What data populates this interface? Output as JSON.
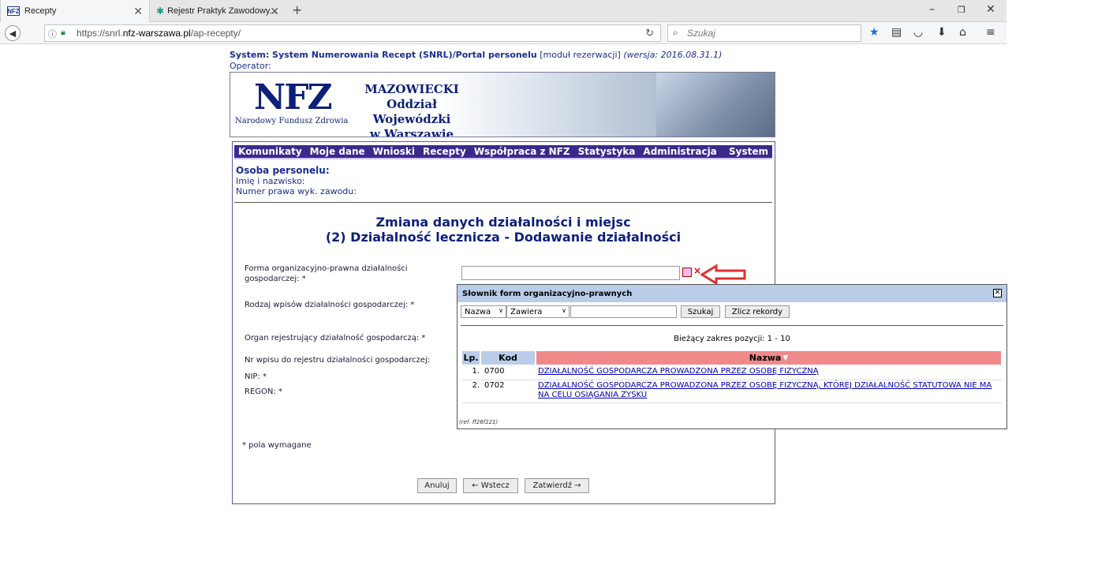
{
  "browser": {
    "tabs": [
      {
        "label": "Recepty",
        "icon": "NFZ"
      },
      {
        "label": "Rejestr Praktyk Zawodowy..."
      }
    ],
    "url_prefix": "https://snrl.",
    "url_domain": "nfz-warszawa.pl",
    "url_path": "/ap-recepty/",
    "search_placeholder": "Szukaj"
  },
  "header": {
    "system_bold": "System: System Numerowania Recept (SNRL)/Portal personelu",
    "system_module": " [moduł rezerwacji] ",
    "system_version": "(wersja: 2016.08.31.1)",
    "operator": "Operator:"
  },
  "banner": {
    "logo": "NFZ",
    "logo_sub": "Narodowy Fundusz Zdrowia",
    "line1": "MAZOWIECKI",
    "line2": "Oddział Wojewódzki",
    "line3": "w Warszawie"
  },
  "menu": [
    "Komunikaty",
    "Moje dane",
    "Wnioski",
    "Recepty",
    "Współpraca z NFZ",
    "Statystyka",
    "Administracja",
    "System"
  ],
  "person": {
    "heading": "Osoba personelu:",
    "name_label": "Imię i nazwisko:",
    "license_label": "Numer prawa wyk. zawodu:"
  },
  "form": {
    "title1": "Zmiana danych działalności i miejsc",
    "title2": "(2) Działalność lecznicza - Dodawanie działalności",
    "f1": "Forma organizacyjno-prawna działalności gospodarczej: *",
    "f2": "Rodzaj wpisów działalności gospodarczej: *",
    "f3": "Organ rejestrujący działalność gospodarczą: *",
    "f4": "Nr wpisu do rejestru działalności gospodarczej:",
    "f5": "NIP: *",
    "f6": "REGON: *",
    "required": "* pola wymagane",
    "btn_cancel": "Anuluj",
    "btn_back": "← Wstecz",
    "btn_confirm": "Zatwierdź →"
  },
  "popup": {
    "title": "Słownik form organizacyjno-prawnych",
    "field_select": "Nazwa",
    "op_select": "Zawiera",
    "search_btn": "Szukaj",
    "count_btn": "Zlicz rekordy",
    "range": "Bieżący zakres pozycji: 1 - 10",
    "columns": {
      "lp": "Lp.",
      "kod": "Kod",
      "nazwa": "Nazwa"
    },
    "rows": [
      {
        "lp": "1.",
        "kod": "0700",
        "nazwa": "DZIAŁALNOŚĆ GOSPODARCZA PROWADZONA PRZEZ OSOBĘ FIZYCZNĄ"
      },
      {
        "lp": "2.",
        "kod": "0702",
        "nazwa": "DZIAŁALNOŚĆ GOSPODARCZA PROWADZONA PRZEZ OSOBĘ FIZYCZNĄ, KTÓREJ DZIAŁALNOŚĆ STATUTOWA NIE MA NA CELU OSIĄGANIA ZYSKU"
      }
    ],
    "ref": "(ref. ff26f221)"
  },
  "colors": {
    "accent": "#3b2a8c",
    "header_blue": "#b9cde9",
    "col_sort": "#f08a8a",
    "col_head": "#b9cde9"
  }
}
